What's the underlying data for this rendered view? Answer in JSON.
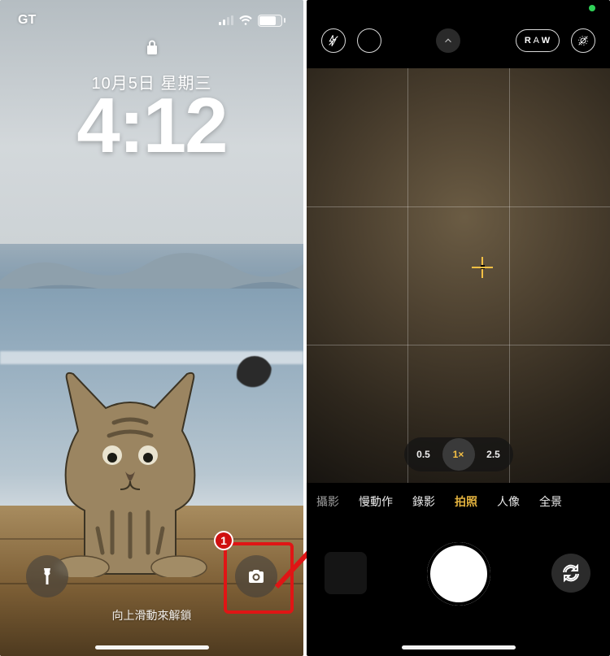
{
  "lock": {
    "carrier": "GT",
    "battery": "72",
    "date": "10月5日 星期三",
    "time": "4:12",
    "hint": "向上滑動來解鎖"
  },
  "annotation": {
    "badge": "1"
  },
  "camera": {
    "raw_label_a": "R",
    "raw_label_b": "A",
    "raw_label_c": "W",
    "zoom": {
      "w": "0.5",
      "x": "1",
      "xs": "×",
      "t": "2.5"
    },
    "modes": {
      "m0": "攝影",
      "m1": "慢動作",
      "m2": "錄影",
      "m3": "拍照",
      "m4": "人像",
      "m5": "全景"
    }
  }
}
